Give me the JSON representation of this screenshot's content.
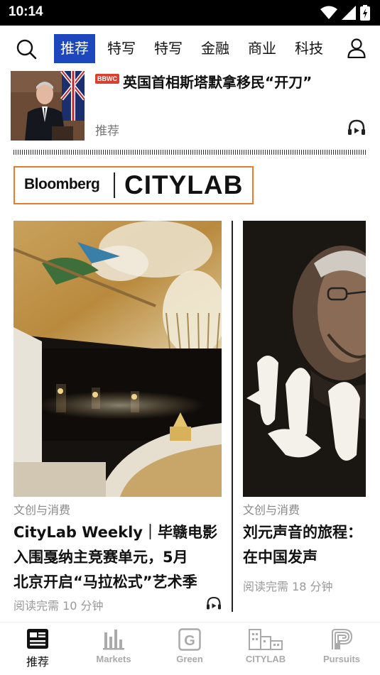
{
  "status_bar": {
    "time": "10:14"
  },
  "nav": {
    "tabs": [
      {
        "label": "推荐",
        "active": true
      },
      {
        "label": "特写"
      },
      {
        "label": "特写"
      },
      {
        "label": "金融"
      },
      {
        "label": "商业"
      },
      {
        "label": "科技"
      }
    ]
  },
  "top_article": {
    "badge": "BBWC",
    "title": "英国首相斯塔默拿移民“开刀”",
    "tag": "推荐"
  },
  "citylab": {
    "brand": "Bloomberg",
    "name": "CITYLAB"
  },
  "cards": [
    {
      "category": "文创与消费",
      "title_lines": [
        "CityLab Weekly｜毕赣电影",
        "入围戛纳主竞赛单元，5月",
        "北京开启“马拉松式”艺术季"
      ],
      "meta": "阅读完需 10 分钟"
    },
    {
      "category": "文创与消费",
      "title_lines": [
        "刘元声音的旅程：",
        "在中国发声"
      ],
      "meta": "阅读完需 18 分钟"
    }
  ],
  "bottom_nav": [
    {
      "label": "推荐",
      "icon": "news-icon",
      "active": true
    },
    {
      "label": "Markets",
      "icon": "bar-chart-icon"
    },
    {
      "label": "Green",
      "icon": "green-g-icon"
    },
    {
      "label": "CITYLAB",
      "icon": "city-skyline-icon"
    },
    {
      "label": "Pursuits",
      "icon": "pursuits-p-icon"
    }
  ],
  "colors": {
    "accent": "#1c47bd",
    "badge": "#d6422f",
    "citylab_border": "#e87c2d"
  }
}
